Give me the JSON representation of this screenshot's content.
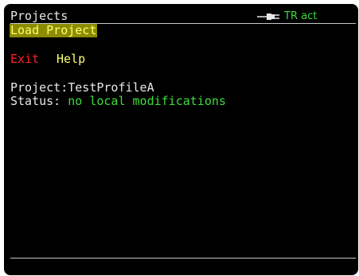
{
  "header": {
    "title": "Projects",
    "connection_icon": "plug-icon",
    "connection_status": "TR act"
  },
  "menu": {
    "selected_item": "Load Project",
    "exit_label": "Exit",
    "help_label": "Help"
  },
  "info": {
    "project_label": "Project:",
    "project_value": "TestProfileA",
    "status_label": "Status:",
    "status_value": "no local modifications"
  },
  "colors": {
    "background": "#000000",
    "text": "#e8e8e8",
    "selection_bg": "#8c8c00",
    "selection_text": "#ffff6e",
    "exit": "#ff2020",
    "help": "#ffff6e",
    "status_green": "#3ddc3d"
  }
}
